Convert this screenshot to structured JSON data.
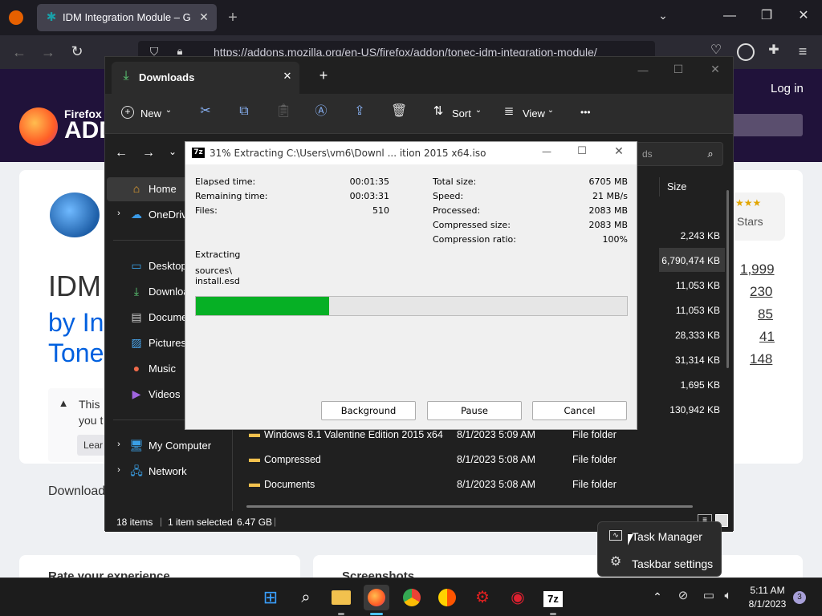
{
  "firefox": {
    "tab_title": "IDM Integration Module – Get this Extension for Firefox",
    "url": "https://addons.mozilla.org/en-US/firefox/addon/tonec-idm-integration-module/",
    "login": "Log in",
    "brand_small": "Firefox",
    "brand_big": "ADD",
    "title_lines": [
      "IDM",
      "by In",
      "Tone"
    ],
    "notice_text_1": "This",
    "notice_text_2": "you t",
    "notice_btn": "Lear",
    "download_label": "Download",
    "stars_label": "Stars",
    "ratings": [
      "1,999",
      "230",
      "85",
      "41",
      "148"
    ],
    "rate_header": "Rate your experience",
    "screenshots_header": "Screenshots"
  },
  "explorer": {
    "tab_title": "Downloads",
    "toolbar": {
      "new": "New",
      "sort": "Sort",
      "view": "View",
      "more": "•••"
    },
    "search_hint": "ds",
    "column_size": "Size",
    "sidebar": [
      {
        "icon": "home-icon",
        "label": "Home"
      },
      {
        "icon": "onedrive-icon",
        "label": "OneDrive"
      },
      {
        "icon": "desktop-icon",
        "label": "Desktop"
      },
      {
        "icon": "download-icon",
        "label": "Downloads"
      },
      {
        "icon": "documents-icon",
        "label": "Documents"
      },
      {
        "icon": "pictures-icon",
        "label": "Pictures"
      },
      {
        "icon": "music-icon",
        "label": "Music"
      },
      {
        "icon": "videos-icon",
        "label": "Videos"
      },
      {
        "icon": "computer-icon",
        "label": "My Computer"
      },
      {
        "icon": "network-icon",
        "label": "Network"
      }
    ],
    "sizes": [
      "2,243 KB",
      "6,790,474 KB",
      "11,053 KB",
      "11,053 KB",
      "28,333 KB",
      "31,314 KB",
      "1,695 KB",
      "130,942 KB"
    ],
    "files": [
      {
        "name": "Windows 8.1 Valentine Edition 2015 x64",
        "date": "8/1/2023 5:09 AM",
        "type": "File folder"
      },
      {
        "name": "Compressed",
        "date": "8/1/2023 5:08 AM",
        "type": "File folder"
      },
      {
        "name": "Documents",
        "date": "8/1/2023 5:08 AM",
        "type": "File folder"
      }
    ],
    "status": {
      "items": "18 items",
      "selected": "1 item selected",
      "size": "6.47 GB"
    }
  },
  "zip": {
    "title": "31% Extracting C:\\Users\\vm6\\Downl ... ition 2015 x64.iso",
    "left_labels": [
      "Elapsed time:",
      "Remaining time:",
      "Files:"
    ],
    "left_values": [
      "00:01:35",
      "00:03:31",
      "510"
    ],
    "right_labels": [
      "Total size:",
      "Speed:",
      "Processed:",
      "Compressed size:",
      "Compression ratio:"
    ],
    "right_values": [
      "6705 MB",
      "21 MB/s",
      "2083 MB",
      "2083 MB",
      "100%"
    ],
    "action": "Extracting",
    "path_1": "sources\\",
    "path_2": "install.esd",
    "progress": 0.31,
    "buttons": {
      "background": "Background",
      "pause": "Pause",
      "cancel": "Cancel"
    }
  },
  "context_menu": {
    "task_manager": "Task Manager",
    "taskbar_settings": "Taskbar settings"
  },
  "taskbar": {
    "time": "5:11 AM",
    "date": "8/1/2023",
    "notif_count": "3",
    "zip_label": "7z"
  }
}
